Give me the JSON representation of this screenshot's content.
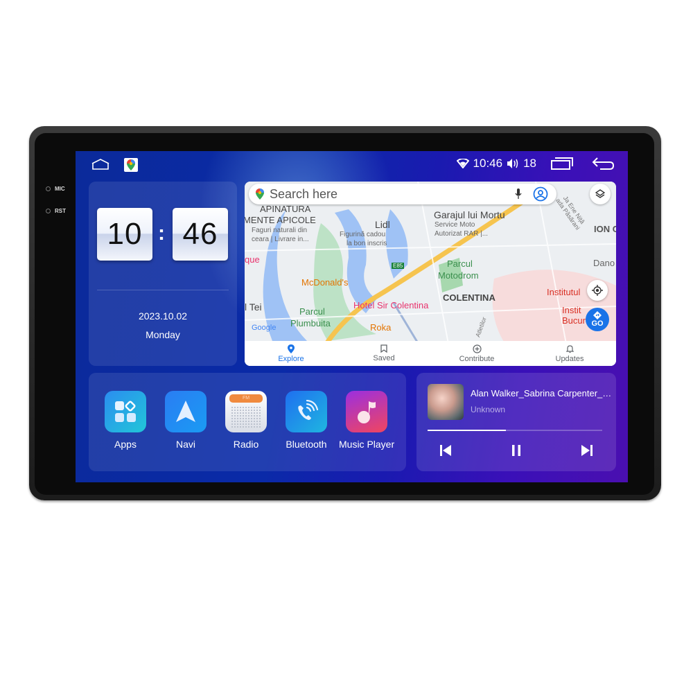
{
  "device": {
    "side_labels": [
      "MIC",
      "RST"
    ]
  },
  "statusbar": {
    "left_icons": [
      "home-icon",
      "google-maps-icon"
    ],
    "time": "10:46",
    "volume": "18",
    "right_icons": [
      "wifi-icon",
      "volume-icon",
      "recent-apps-icon",
      "back-icon"
    ]
  },
  "clock_widget": {
    "hours": "10",
    "minutes": "46",
    "separator": ":",
    "date": "2023.10.02",
    "weekday": "Monday"
  },
  "map_widget": {
    "search_placeholder": "Search here",
    "go_label": "GO",
    "google_logo": "Google",
    "labels": [
      {
        "text": "APINATURA",
        "kind": "poi"
      },
      {
        "text": "MENTE APICOLE",
        "kind": "poi"
      },
      {
        "text": "Faguri naturali din",
        "kind": "sub"
      },
      {
        "text": "ceara | Livrare in...",
        "kind": "sub"
      },
      {
        "text": "Lidl",
        "kind": "poi"
      },
      {
        "text": "Figurină cadou",
        "kind": "sub"
      },
      {
        "text": "la bon inscris",
        "kind": "sub"
      },
      {
        "text": "Garajul lui Mortu",
        "kind": "poi"
      },
      {
        "text": "Service Moto",
        "kind": "sub"
      },
      {
        "text": "Autorizat RAR |...",
        "kind": "sub"
      },
      {
        "text": "ION C",
        "kind": "district"
      },
      {
        "text": "Dano",
        "kind": "poi"
      },
      {
        "text": "Parcul",
        "kind": "park"
      },
      {
        "text": "Motodrom",
        "kind": "park"
      },
      {
        "text": "McDonald's",
        "kind": "food"
      },
      {
        "text": "COLENTINA",
        "kind": "district"
      },
      {
        "text": "Institutul",
        "kind": "hospital"
      },
      {
        "text": "Hotel Sir Colentina",
        "kind": "hotel"
      },
      {
        "text": "l Tei",
        "kind": "district"
      },
      {
        "text": "Parcul",
        "kind": "park"
      },
      {
        "text": "Plumbuita",
        "kind": "park"
      },
      {
        "text": "Roka",
        "kind": "food"
      },
      {
        "text": "Instit",
        "kind": "hospital"
      },
      {
        "text": "Bucur",
        "kind": "hospital"
      },
      {
        "text": "que",
        "kind": "hotel"
      },
      {
        "text": "E85",
        "kind": "road"
      },
      {
        "text": "Atletilor",
        "kind": "street"
      },
      {
        "text": "ada Păsărani",
        "kind": "street"
      },
      {
        "text": "Ja Ene Niță",
        "kind": "street"
      }
    ],
    "nav_tabs": [
      {
        "label": "Explore",
        "icon": "location-pin-icon",
        "active": true
      },
      {
        "label": "Saved",
        "icon": "bookmark-icon",
        "active": false
      },
      {
        "label": "Contribute",
        "icon": "add-circle-icon",
        "active": false
      },
      {
        "label": "Updates",
        "icon": "bell-icon",
        "active": false
      }
    ]
  },
  "apps": [
    {
      "label": "Apps",
      "icon": "apps-grid-icon"
    },
    {
      "label": "Navi",
      "icon": "navigation-arrow-icon"
    },
    {
      "label": "Radio",
      "icon": "fm-radio-icon",
      "badge": "FM"
    },
    {
      "label": "Bluetooth",
      "icon": "bluetooth-phone-icon"
    },
    {
      "label": "Music Player",
      "icon": "music-note-icon"
    }
  ],
  "music": {
    "title": "Alan Walker_Sabrina Carpenter_F...",
    "artist": "Unknown",
    "progress_percent": 45
  },
  "colors": {
    "accent": "#1a73e8",
    "screen_blue": "#0b2aa0",
    "screen_purple": "#4a0fb0"
  }
}
